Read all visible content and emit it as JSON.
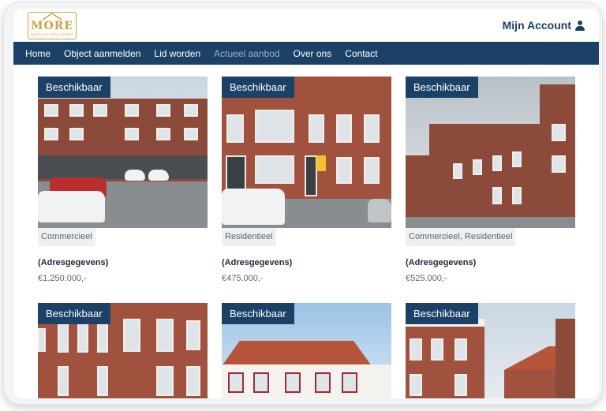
{
  "header": {
    "logo_text": "MORE",
    "logo_subtext": "MATCH OF REAL ESTATE",
    "account_label": "Mijn Account"
  },
  "nav": {
    "items": [
      {
        "label": "Home"
      },
      {
        "label": "Object aanmelden"
      },
      {
        "label": "Lid worden"
      },
      {
        "label": "Actueel aanbod"
      },
      {
        "label": "Over ons"
      },
      {
        "label": "Contact"
      }
    ],
    "active": "Actueel aanbod"
  },
  "listings": [
    {
      "badge": "Beschikbaar",
      "type": "Commercieel",
      "address": "(Adresgegevens)",
      "price": "€1.250.000,-"
    },
    {
      "badge": "Beschikbaar",
      "type": "Residentieel",
      "address": "(Adresgegevens)",
      "price": "€475.000,-"
    },
    {
      "badge": "Beschikbaar",
      "type": "Commercieel, Residentieel",
      "address": "(Adresgegevens)",
      "price": "€525.000,-"
    },
    {
      "badge": "Beschikbaar"
    },
    {
      "badge": "Beschikbaar"
    },
    {
      "badge": "Beschikbaar"
    }
  ],
  "colors": {
    "navbar": "#1b4167",
    "nav_active": "#9db0c4",
    "badge": "#1b4167",
    "logo_gold": "#c9a24b",
    "account_text": "#1c3e63"
  },
  "icons": {
    "account": "user-icon",
    "logo": "house-logo-icon"
  }
}
